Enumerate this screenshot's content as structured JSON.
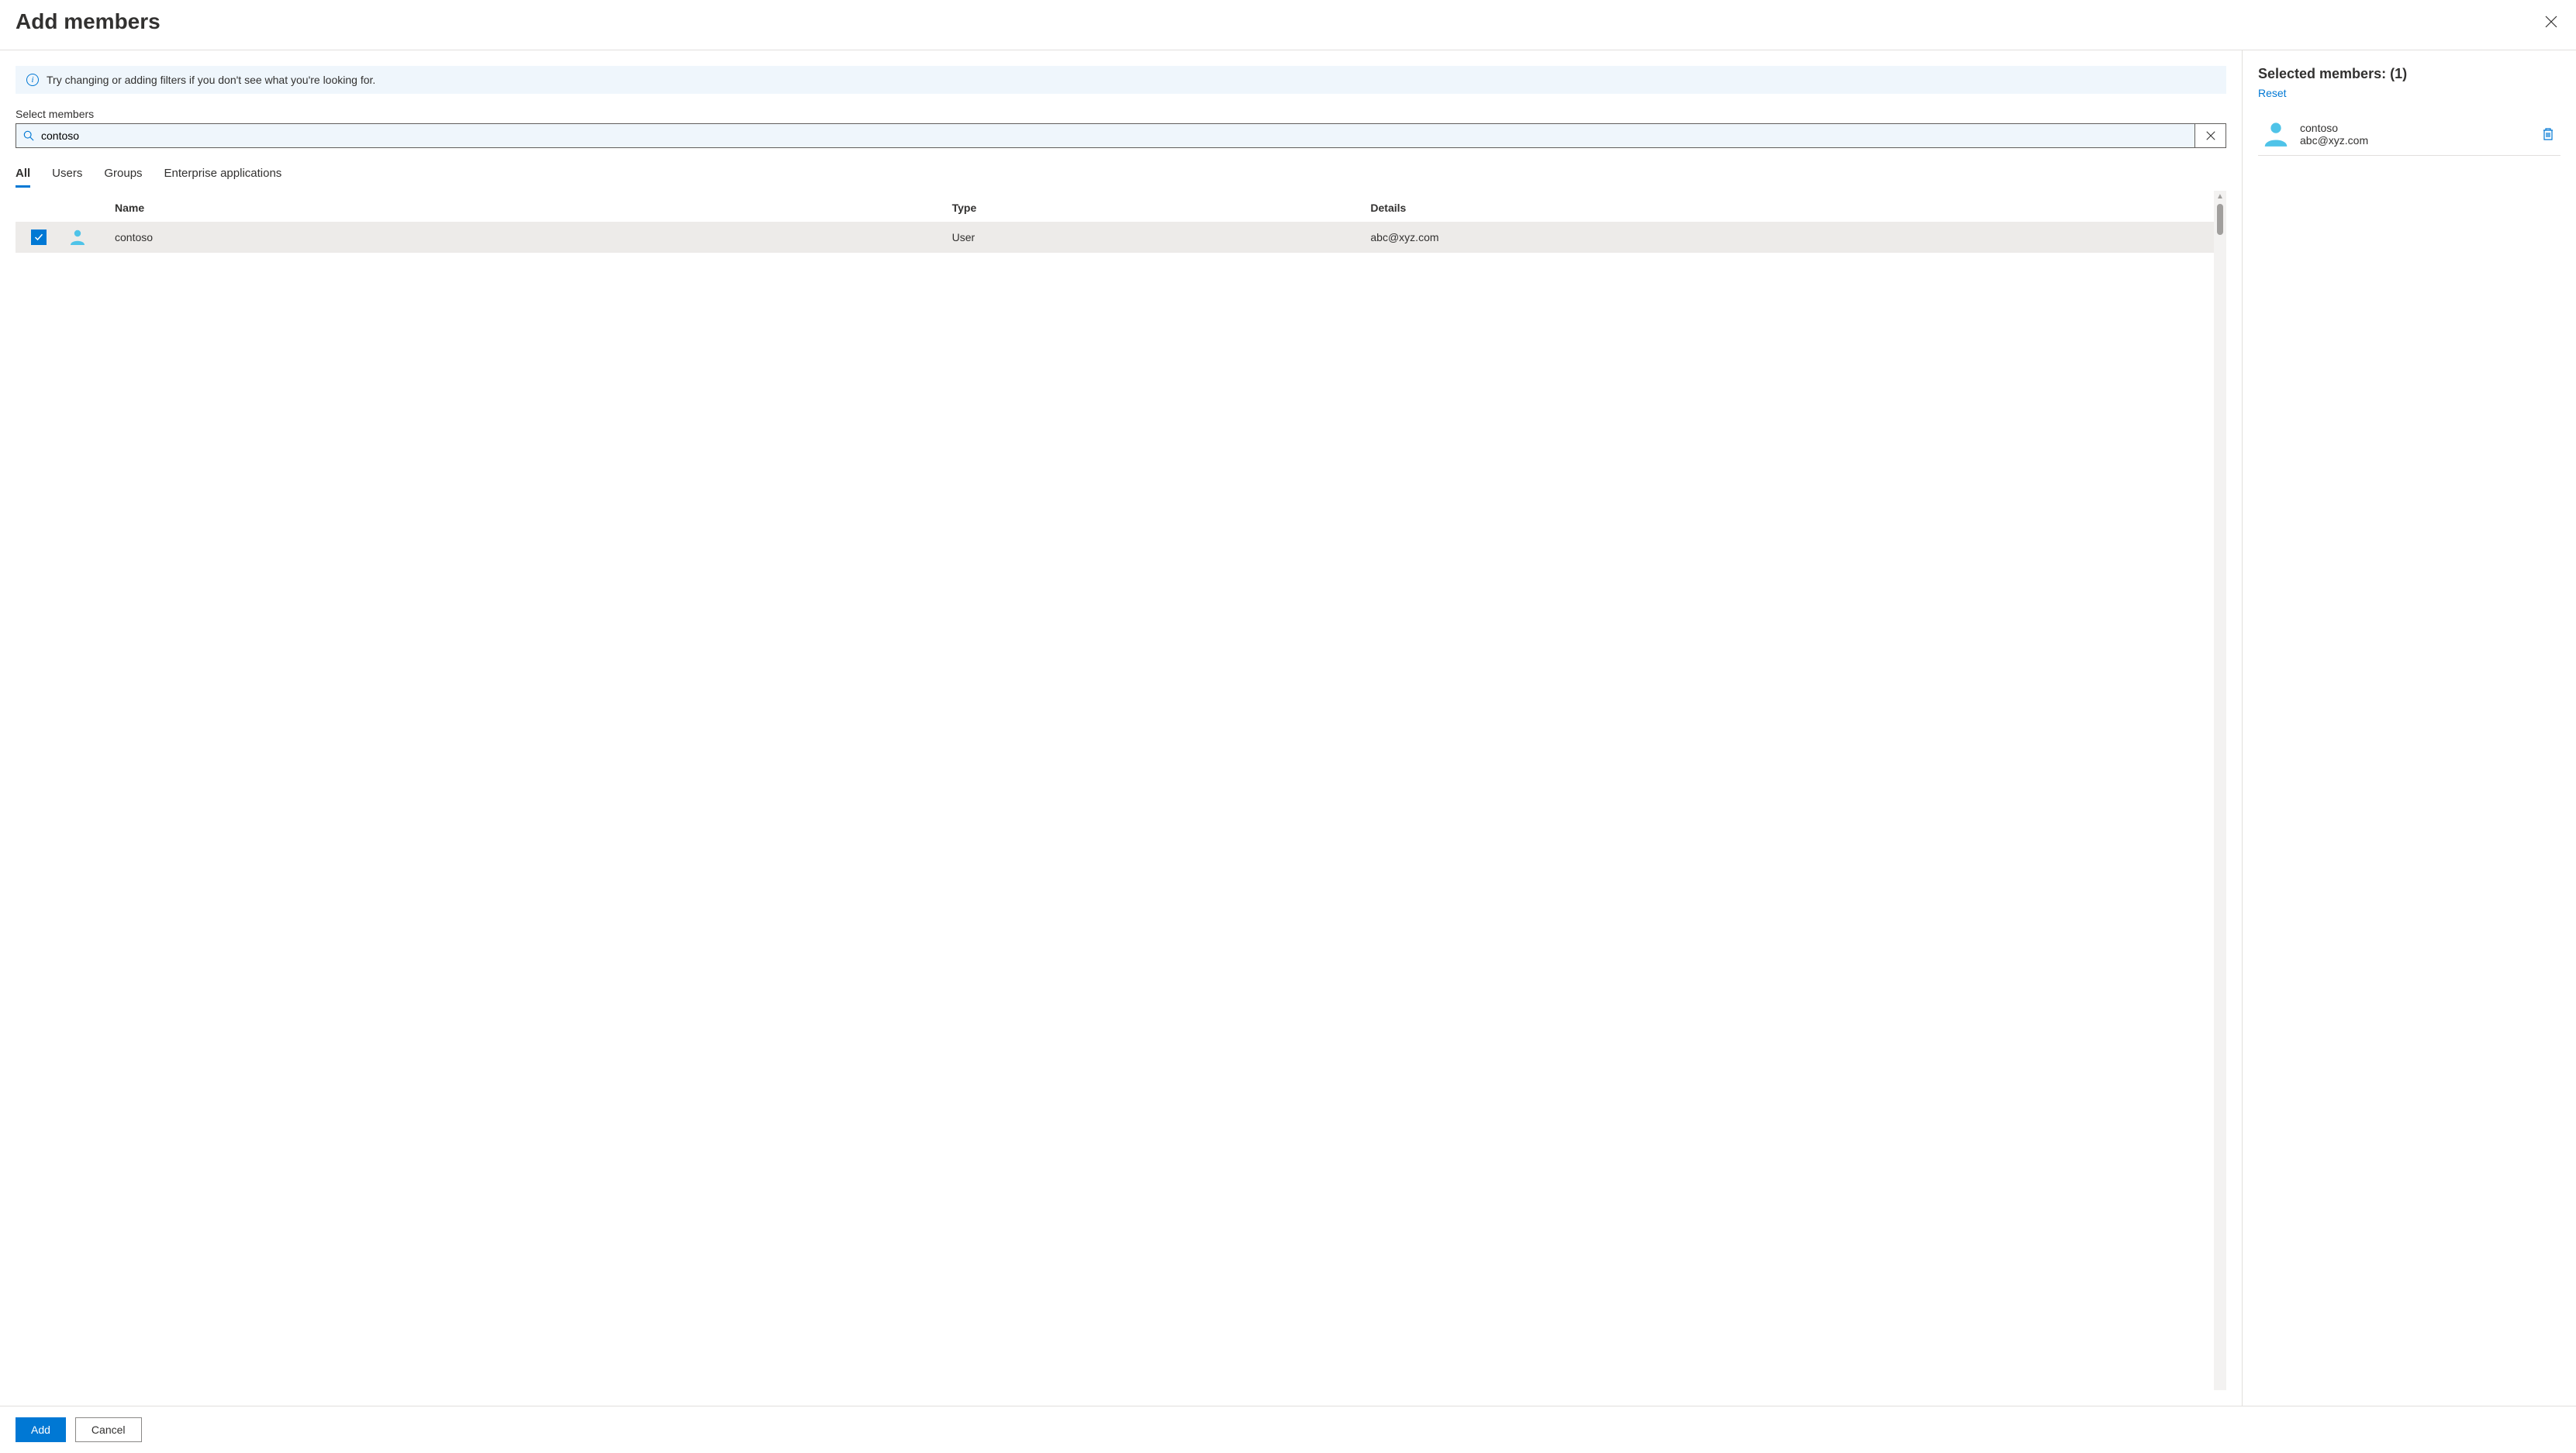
{
  "header": {
    "title": "Add members"
  },
  "info_banner": "Try changing or adding filters if you don't see what you're looking for.",
  "search": {
    "label": "Select members",
    "value": "contoso",
    "placeholder": ""
  },
  "tabs": [
    {
      "label": "All",
      "active": true
    },
    {
      "label": "Users",
      "active": false
    },
    {
      "label": "Groups",
      "active": false
    },
    {
      "label": "Enterprise applications",
      "active": false
    }
  ],
  "columns": {
    "name": "Name",
    "type": "Type",
    "details": "Details"
  },
  "results": [
    {
      "checked": true,
      "name": "contoso",
      "type": "User",
      "details": "abc@xyz.com"
    }
  ],
  "selected": {
    "title_prefix": "Selected members:",
    "count_display": "(1)",
    "reset": "Reset",
    "items": [
      {
        "name": "contoso",
        "details": "abc@xyz.com"
      }
    ]
  },
  "footer": {
    "add": "Add",
    "cancel": "Cancel"
  }
}
